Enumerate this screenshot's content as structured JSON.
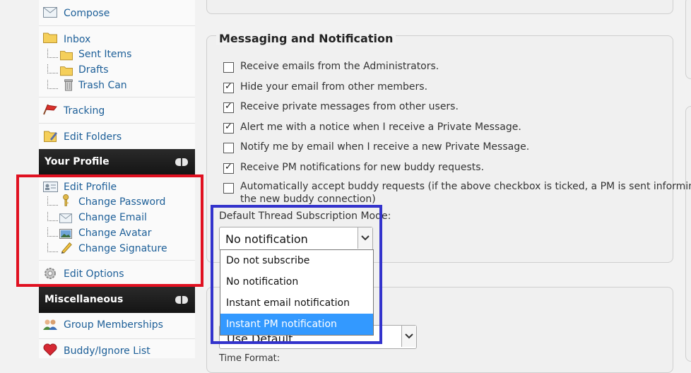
{
  "sidebar": {
    "compose": "Compose",
    "inbox": "Inbox",
    "inbox_children": [
      "Sent Items",
      "Drafts",
      "Trash Can"
    ],
    "tracking": "Tracking",
    "edit_folders": "Edit Folders",
    "your_profile": "Your Profile",
    "edit_profile": "Edit Profile",
    "profile_children": [
      "Change Password",
      "Change Email",
      "Change Avatar",
      "Change Signature"
    ],
    "edit_options": "Edit Options",
    "miscellaneous": "Miscellaneous",
    "group_memberships": "Group Memberships",
    "buddy_ignore": "Buddy/Ignore List"
  },
  "main": {
    "section_title": "Messaging and Notification",
    "checkboxes": [
      {
        "label": "Receive emails from the Administrators.",
        "checked": false
      },
      {
        "label": "Hide your email from other members.",
        "checked": true
      },
      {
        "label": "Receive private messages from other users.",
        "checked": true
      },
      {
        "label": "Alert me with a notice when I receive a Private Message.",
        "checked": true
      },
      {
        "label": "Notify me by email when I receive a new Private Message.",
        "checked": false
      },
      {
        "label": "Receive PM notifications for new buddy requests.",
        "checked": true
      },
      {
        "label": "Automatically accept buddy requests (if the above checkbox is ticked, a PM is sent informing of",
        "label2": "the new buddy connection)",
        "checked": false
      }
    ],
    "subscription_label": "Default Thread Subscription Mode:",
    "subscription_value": "No notification",
    "subscription_options": [
      "Do not subscribe",
      "No notification",
      "Instant email notification",
      "Instant PM notification"
    ],
    "highlighted_option": "Instant PM notification",
    "second_select_value": "Use Default",
    "time_format_label": "Time Format:"
  },
  "colors": {
    "link": "#1d5f98",
    "highlight_red": "#e01020",
    "highlight_blue": "#3333cc",
    "option_selected": "#3399ff"
  }
}
